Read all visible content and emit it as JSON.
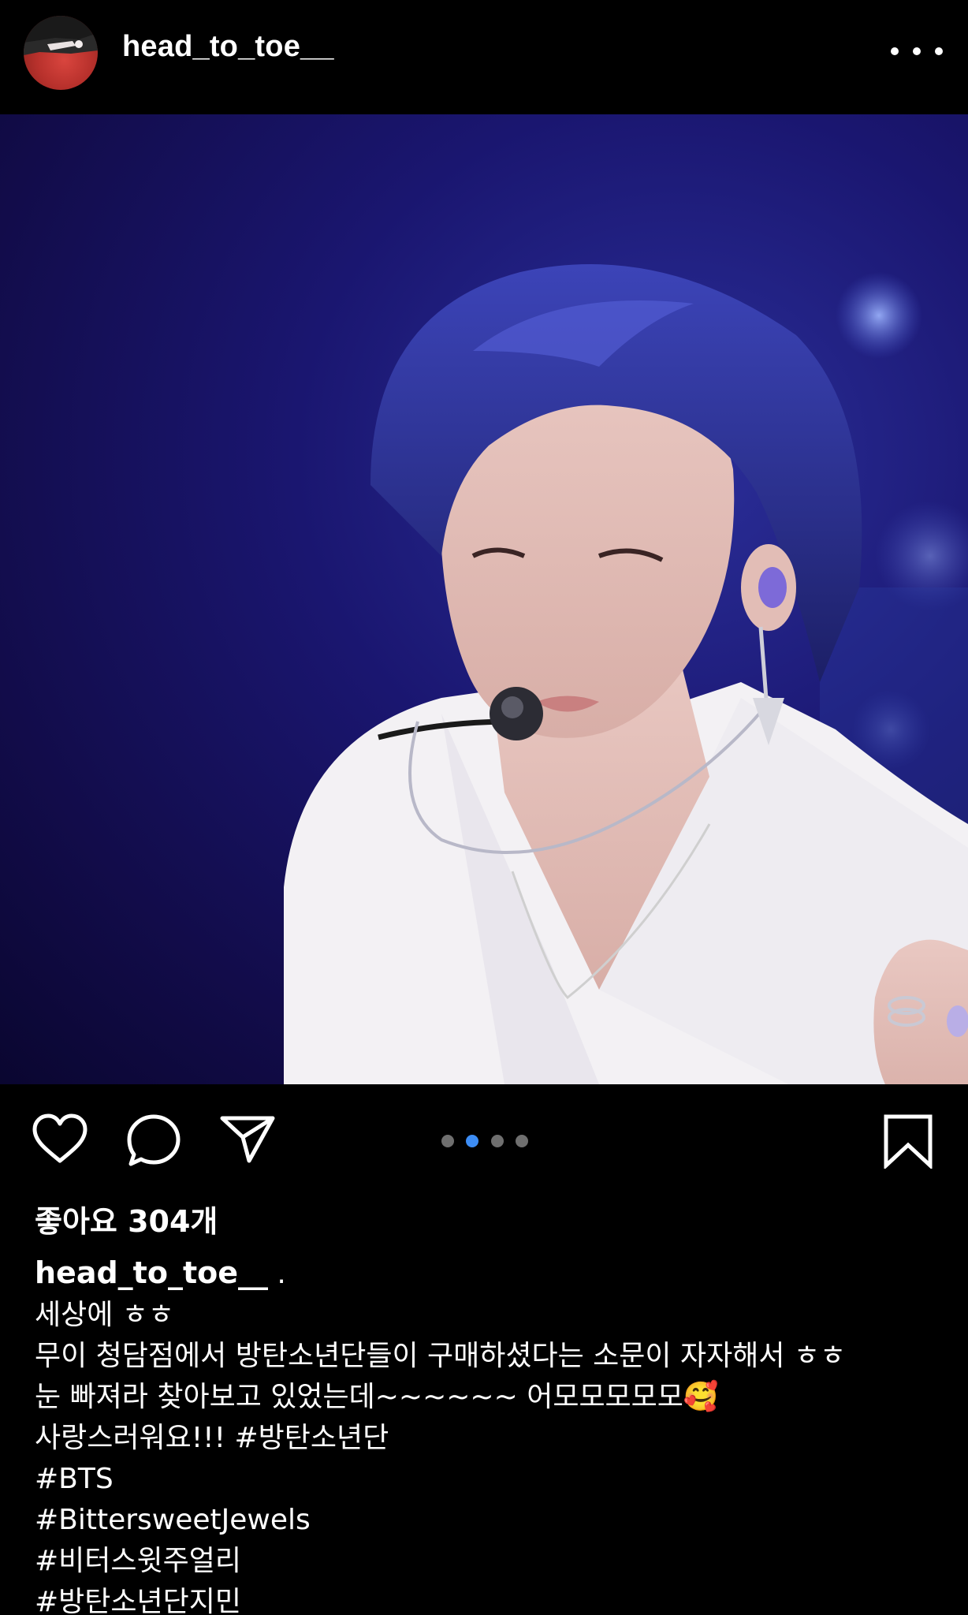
{
  "header": {
    "username": "head_to_toe__",
    "avatar_icon": "avatar-image",
    "more_icon": "more-options-icon"
  },
  "post": {
    "image_description_icon": "post-photo",
    "carousel": {
      "total": 4,
      "active_index": 1,
      "active_color": "#3d8df5",
      "inactive_color": "#6f6f6f"
    }
  },
  "actions": {
    "like_icon": "heart-icon",
    "comment_icon": "comment-bubble-icon",
    "share_icon": "paper-plane-icon",
    "save_icon": "bookmark-icon"
  },
  "likes": {
    "text": "좋아요 304개"
  },
  "caption": {
    "username": "head_to_toe__",
    "after_username": " .",
    "lines": [
      "세상에 ㅎㅎ",
      "무이 청담점에서 방탄소년단들이 구매하셨다는 소문이 자자해서 ㅎㅎ",
      "눈 빠져라 찾아보고 있었는데~~~~~~ 어모모모모모🥰",
      "사랑스러워요!!! #방탄소년단",
      "#BTS",
      "#BittersweetJewels",
      "#비터스윗주얼리",
      "#방탄소년단지민"
    ]
  }
}
